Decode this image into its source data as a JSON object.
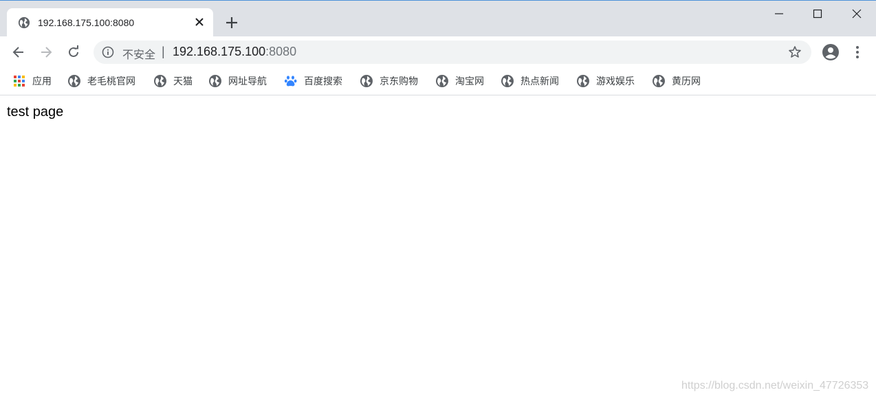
{
  "tab": {
    "title": "192.168.175.100:8080"
  },
  "address_bar": {
    "security_label": "不安全",
    "separator": "|",
    "url_host": "192.168.175.100",
    "url_port": ":8080"
  },
  "bookmarks": [
    {
      "label": "应用",
      "icon": "apps-grid-icon"
    },
    {
      "label": "老毛桃官网",
      "icon": "globe-icon"
    },
    {
      "label": "天猫",
      "icon": "globe-icon"
    },
    {
      "label": "网址导航",
      "icon": "globe-icon"
    },
    {
      "label": "百度搜索",
      "icon": "baidu-paw-icon"
    },
    {
      "label": "京东购物",
      "icon": "globe-icon"
    },
    {
      "label": "淘宝网",
      "icon": "globe-icon"
    },
    {
      "label": "热点新闻",
      "icon": "globe-icon"
    },
    {
      "label": "游戏娱乐",
      "icon": "globe-icon"
    },
    {
      "label": "黄历网",
      "icon": "globe-icon"
    }
  ],
  "page": {
    "body_text": "test page"
  },
  "watermark": {
    "text": "https://blog.csdn.net/weixin_47726353"
  },
  "colors": {
    "tabstrip": "#dee1e6",
    "omnibox": "#f1f3f4",
    "icon_gray": "#5f6368",
    "baidu_blue": "#3385ff"
  }
}
